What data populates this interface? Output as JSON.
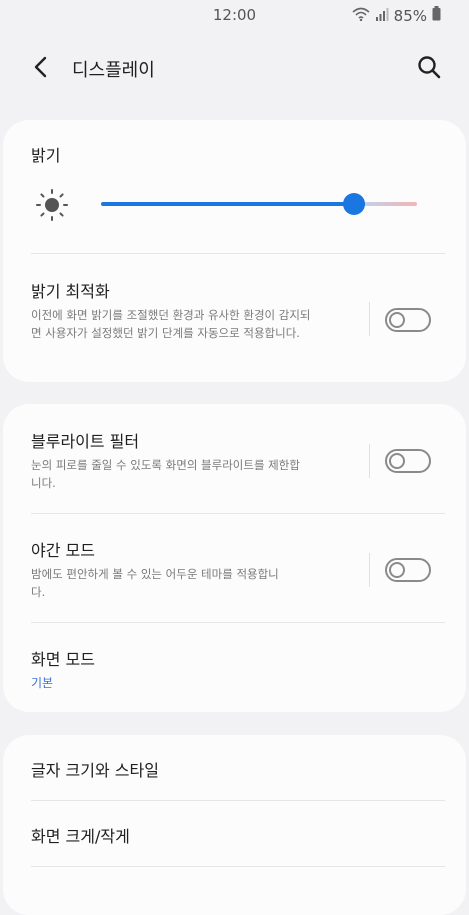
{
  "status_bar": {
    "time": "12:00",
    "battery": "85%",
    "icons": [
      "wifi-icon",
      "signal-icon",
      "battery-icon"
    ]
  },
  "app_bar": {
    "title": "디스플레이",
    "back_icon": "back-arrow-icon",
    "search_icon": "search-icon"
  },
  "brightness": {
    "title": "밝기",
    "icon": "sun-icon",
    "level": 0.8
  },
  "adaptive_brightness": {
    "title": "밝기 최적화",
    "description": "이전에 화면 밝기를 조절했던 환경과 유사한 환경이 감지되면 사용자가 설정했던 밝기 단계를 자동으로 적용합니다.",
    "enabled": false
  },
  "blue_light_filter": {
    "title": "블루라이트 필터",
    "description": "눈의 피로를 줄일 수 있도록 화면의 블루라이트를 제한합니다.",
    "enabled": false
  },
  "night_mode": {
    "title": "야간 모드",
    "description": "밤에도 편안하게 볼 수 있는 어두운 테마를 적용합니다.",
    "enabled": false
  },
  "screen_mode": {
    "title": "화면 모드",
    "value": "기본"
  },
  "font_size_style": {
    "title": "글자 크기와 스타일"
  },
  "screen_zoom": {
    "title": "화면 크게/작게"
  },
  "colors": {
    "accent": "#1a76e0",
    "link": "#3a72d8",
    "background": "#f2f1f3",
    "card": "#fcfcfc"
  }
}
